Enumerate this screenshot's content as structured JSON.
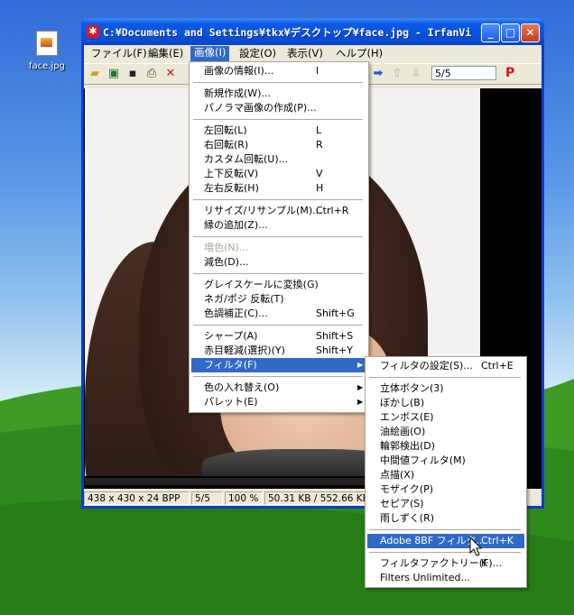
{
  "desktop": {
    "icon_label": "face.jpg"
  },
  "window": {
    "title": "C:¥Documents and Settings¥tkx¥デスクトップ¥face.jpg - IrfanVi...",
    "menu": [
      "ファイル(F)",
      "編集(E)",
      "画像(I)",
      "設定(O)",
      "表示(V)",
      "ヘルプ(H)"
    ],
    "page_field": "5/5",
    "status": [
      "438 x 430 x 24 BPP",
      "5/5",
      "100 %",
      "50.31 KB / 552.66 KB"
    ]
  },
  "image_menu": {
    "items": [
      {
        "label": "画像の情報(I)...",
        "shortcut": "I"
      },
      {
        "label": "新規作成(W)...",
        "shortcut": ""
      },
      {
        "label": "パノラマ画像の作成(P)...",
        "shortcut": ""
      },
      {
        "label": "左回転(L)",
        "shortcut": "L"
      },
      {
        "label": "右回転(R)",
        "shortcut": "R"
      },
      {
        "label": "カスタム回転(U)...",
        "shortcut": ""
      },
      {
        "label": "上下反転(V)",
        "shortcut": "V"
      },
      {
        "label": "左右反転(H)",
        "shortcut": "H"
      },
      {
        "label": "リサイズ/リサンプル(M)...",
        "shortcut": "Ctrl+R"
      },
      {
        "label": "縁の追加(Z)...",
        "shortcut": ""
      },
      {
        "label": "増色(N)...",
        "shortcut": ""
      },
      {
        "label": "減色(D)...",
        "shortcut": ""
      },
      {
        "label": "グレイスケールに変換(G)",
        "shortcut": ""
      },
      {
        "label": "ネガ/ポジ 反転(T)",
        "shortcut": ""
      },
      {
        "label": "色調補正(C)...",
        "shortcut": "Shift+G"
      },
      {
        "label": "シャープ(A)",
        "shortcut": "Shift+S"
      },
      {
        "label": "赤目軽減(選択)(Y)",
        "shortcut": "Shift+Y"
      },
      {
        "label": "フィルタ(F)",
        "shortcut": ""
      },
      {
        "label": "色の入れ替え(O)",
        "shortcut": ""
      },
      {
        "label": "パレット(E)",
        "shortcut": ""
      }
    ]
  },
  "filter_menu": {
    "items": [
      {
        "label": "フィルタの設定(S)...",
        "shortcut": "Ctrl+E"
      },
      {
        "label": "立体ボタン(3)",
        "shortcut": ""
      },
      {
        "label": "ぼかし(B)",
        "shortcut": ""
      },
      {
        "label": "エンボス(E)",
        "shortcut": ""
      },
      {
        "label": "油絵画(O)",
        "shortcut": ""
      },
      {
        "label": "輪郭検出(D)",
        "shortcut": ""
      },
      {
        "label": "中間値フィルタ(M)",
        "shortcut": ""
      },
      {
        "label": "点描(X)",
        "shortcut": ""
      },
      {
        "label": "モザイク(P)",
        "shortcut": ""
      },
      {
        "label": "セピア(S)",
        "shortcut": ""
      },
      {
        "label": "雨しずく(R)",
        "shortcut": ""
      },
      {
        "label": "Adobe 8BF フィルタ...",
        "shortcut": "Ctrl+K"
      },
      {
        "label": "フィルタファクトリー(F)...",
        "shortcut": "K"
      },
      {
        "label": "Filters Unlimited...",
        "shortcut": ""
      }
    ]
  }
}
